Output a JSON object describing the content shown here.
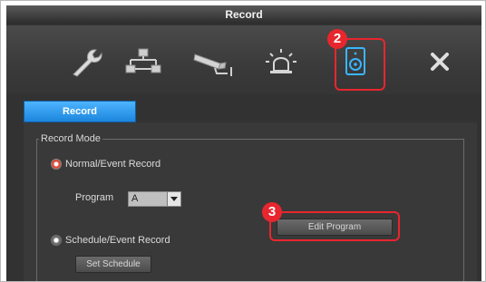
{
  "window": {
    "title": "Record"
  },
  "toolbar": {
    "items": [
      {
        "icon": "wrench-icon"
      },
      {
        "icon": "network-icon"
      },
      {
        "icon": "camera-icon"
      },
      {
        "icon": "alarm-icon"
      },
      {
        "icon": "record-drive-icon",
        "selected": true
      },
      {
        "icon": "close-icon"
      }
    ]
  },
  "annotations": {
    "badge_2": "2",
    "badge_3": "3"
  },
  "tab": {
    "label": "Record"
  },
  "record_mode": {
    "legend": "Record Mode",
    "normal": {
      "label": "Normal/Event Record",
      "selected": true
    },
    "program": {
      "label": "Program",
      "value": "A"
    },
    "edit_program_label": "Edit Program",
    "schedule": {
      "label": "Schedule/Event Record",
      "selected": false
    },
    "set_schedule_label": "Set Schedule"
  },
  "colors": {
    "accent_blue": "#1c86dd",
    "highlight_red": "#e8262e"
  }
}
